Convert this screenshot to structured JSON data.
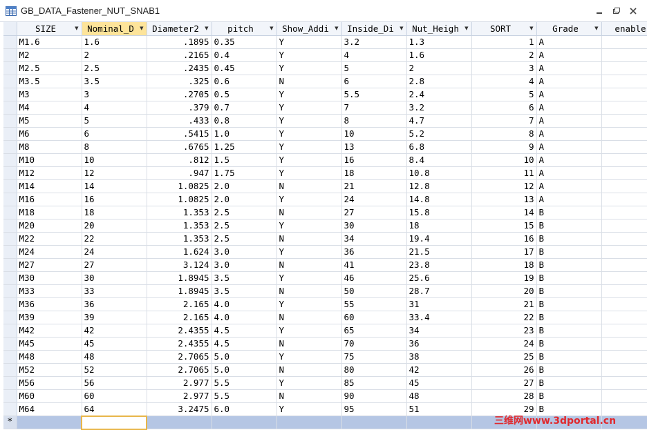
{
  "window": {
    "title": "GB_DATA_Fastener_NUT_SNAB1",
    "table_icon": "table-icon",
    "controls": [
      "minimize-icon",
      "restore-icon",
      "close-icon"
    ]
  },
  "columns": [
    "SIZE",
    "Nominal_D",
    "Diameter2",
    "pitch",
    "Show_Addi",
    "Inside_Di",
    "Nut_Heigh",
    "SORT",
    "Grade",
    "enable"
  ],
  "active_column": "Nominal_D",
  "rows": [
    [
      "M1.6",
      "1.6",
      ".1895",
      "0.35",
      "Y",
      "3.2",
      "1.3",
      "1",
      "A",
      ""
    ],
    [
      "M2",
      "2",
      ".2165",
      "0.4",
      "Y",
      "4",
      "1.6",
      "2",
      "A",
      ""
    ],
    [
      "M2.5",
      "2.5",
      ".2435",
      "0.45",
      "Y",
      "5",
      "2",
      "3",
      "A",
      ""
    ],
    [
      "M3.5",
      "3.5",
      ".325",
      "0.6",
      "N",
      "6",
      "2.8",
      "4",
      "A",
      ""
    ],
    [
      "M3",
      "3",
      ".2705",
      "0.5",
      "Y",
      "5.5",
      "2.4",
      "5",
      "A",
      ""
    ],
    [
      "M4",
      "4",
      ".379",
      "0.7",
      "Y",
      "7",
      "3.2",
      "6",
      "A",
      ""
    ],
    [
      "M5",
      "5",
      ".433",
      "0.8",
      "Y",
      "8",
      "4.7",
      "7",
      "A",
      ""
    ],
    [
      "M6",
      "6",
      ".5415",
      "1.0",
      "Y",
      "10",
      "5.2",
      "8",
      "A",
      ""
    ],
    [
      "M8",
      "8",
      ".6765",
      "1.25",
      "Y",
      "13",
      "6.8",
      "9",
      "A",
      ""
    ],
    [
      "M10",
      "10",
      ".812",
      "1.5",
      "Y",
      "16",
      "8.4",
      "10",
      "A",
      ""
    ],
    [
      "M12",
      "12",
      ".947",
      "1.75",
      "Y",
      "18",
      "10.8",
      "11",
      "A",
      ""
    ],
    [
      "M14",
      "14",
      "1.0825",
      "2.0",
      "N",
      "21",
      "12.8",
      "12",
      "A",
      ""
    ],
    [
      "M16",
      "16",
      "1.0825",
      "2.0",
      "Y",
      "24",
      "14.8",
      "13",
      "A",
      ""
    ],
    [
      "M18",
      "18",
      "1.353",
      "2.5",
      "N",
      "27",
      "15.8",
      "14",
      "B",
      ""
    ],
    [
      "M20",
      "20",
      "1.353",
      "2.5",
      "Y",
      "30",
      "18",
      "15",
      "B",
      ""
    ],
    [
      "M22",
      "22",
      "1.353",
      "2.5",
      "N",
      "34",
      "19.4",
      "16",
      "B",
      ""
    ],
    [
      "M24",
      "24",
      "1.624",
      "3.0",
      "Y",
      "36",
      "21.5",
      "17",
      "B",
      ""
    ],
    [
      "M27",
      "27",
      "3.124",
      "3.0",
      "N",
      "41",
      "23.8",
      "18",
      "B",
      ""
    ],
    [
      "M30",
      "30",
      "1.8945",
      "3.5",
      "Y",
      "46",
      "25.6",
      "19",
      "B",
      ""
    ],
    [
      "M33",
      "33",
      "1.8945",
      "3.5",
      "N",
      "50",
      "28.7",
      "20",
      "B",
      ""
    ],
    [
      "M36",
      "36",
      "2.165",
      "4.0",
      "Y",
      "55",
      "31",
      "21",
      "B",
      ""
    ],
    [
      "M39",
      "39",
      "2.165",
      "4.0",
      "N",
      "60",
      "33.4",
      "22",
      "B",
      ""
    ],
    [
      "M42",
      "42",
      "2.4355",
      "4.5",
      "Y",
      "65",
      "34",
      "23",
      "B",
      ""
    ],
    [
      "M45",
      "45",
      "2.4355",
      "4.5",
      "N",
      "70",
      "36",
      "24",
      "B",
      ""
    ],
    [
      "M48",
      "48",
      "2.7065",
      "5.0",
      "Y",
      "75",
      "38",
      "25",
      "B",
      ""
    ],
    [
      "M52",
      "52",
      "2.7065",
      "5.0",
      "N",
      "80",
      "42",
      "26",
      "B",
      ""
    ],
    [
      "M56",
      "56",
      "2.977",
      "5.5",
      "Y",
      "85",
      "45",
      "27",
      "B",
      ""
    ],
    [
      "M60",
      "60",
      "2.977",
      "5.5",
      "N",
      "90",
      "48",
      "28",
      "B",
      ""
    ],
    [
      "M64",
      "64",
      "3.2475",
      "6.0",
      "Y",
      "95",
      "51",
      "29",
      "B",
      ""
    ]
  ],
  "right_aligned_columns": [
    2,
    7
  ],
  "new_row_marker": "*",
  "watermark": "三维网www.3dportal.cn",
  "colors": {
    "active_header": "#fde49a",
    "new_row": "#b5c6e4",
    "watermark": "#e0282c"
  }
}
